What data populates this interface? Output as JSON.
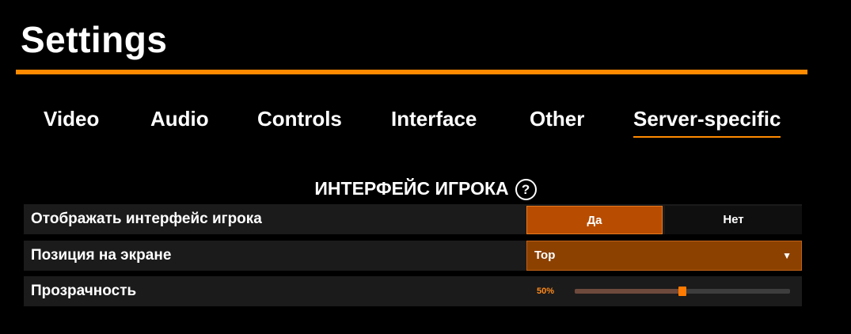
{
  "page_title": "Settings",
  "accent_color": "#ff8a00",
  "tabs": [
    {
      "label": "Video"
    },
    {
      "label": "Audio"
    },
    {
      "label": "Controls"
    },
    {
      "label": "Interface"
    },
    {
      "label": "Other"
    },
    {
      "label": "Server-specific",
      "active": true
    }
  ],
  "section": {
    "title": "ИНТЕРФЕЙС ИГРОКА",
    "help_icon": "question-circle-icon",
    "help_glyph": "?"
  },
  "settings": {
    "show_interface": {
      "label": "Отображать интерфейс игрока",
      "yes_label": "Да",
      "no_label": "Нет",
      "selected": "Да"
    },
    "position": {
      "label": "Позиция на экране",
      "value": "Top",
      "caret": "▼"
    },
    "transparency": {
      "label": "Прозрачность",
      "value_text": "50%",
      "value_fraction": 0.5
    }
  }
}
